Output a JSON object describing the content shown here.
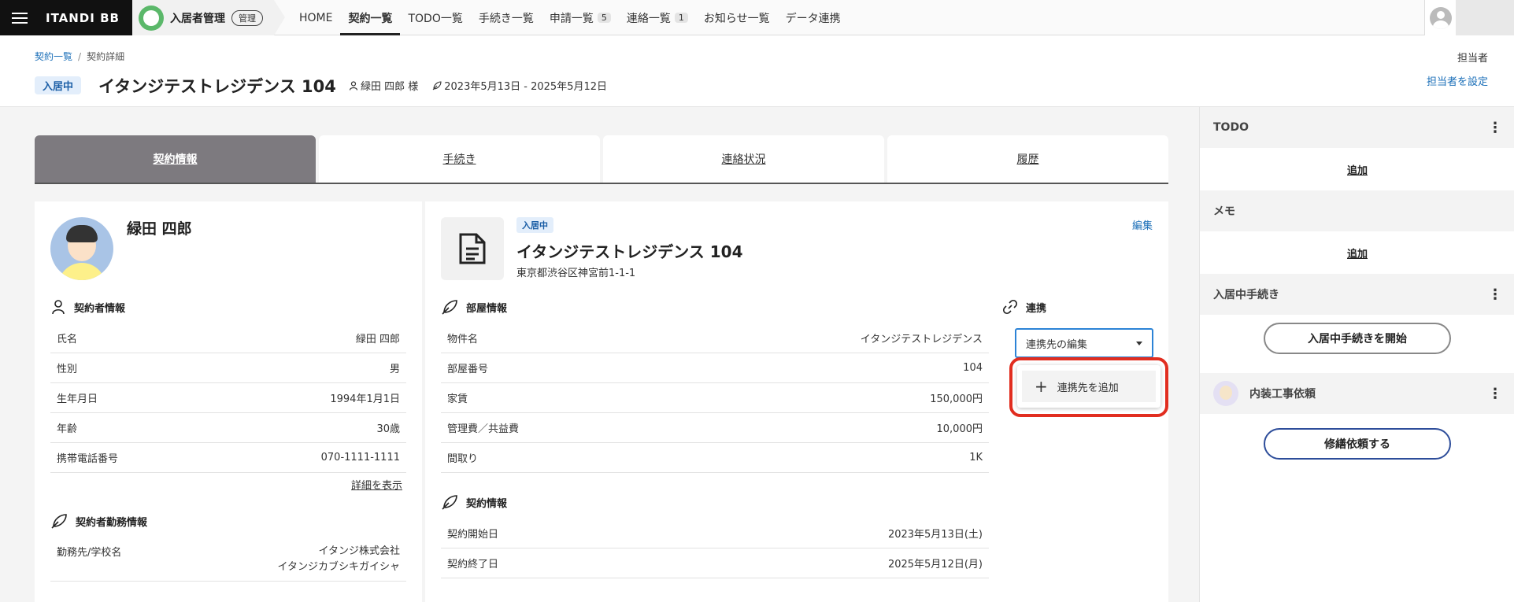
{
  "topbar": {
    "brand": "ITANDI BB",
    "app_name": "入居者管理",
    "app_badge": "管理",
    "nav": [
      {
        "label": "HOME",
        "count": ""
      },
      {
        "label": "契約一覧",
        "count": ""
      },
      {
        "label": "TODO一覧",
        "count": ""
      },
      {
        "label": "手続き一覧",
        "count": ""
      },
      {
        "label": "申請一覧",
        "count": "5"
      },
      {
        "label": "連絡一覧",
        "count": "1"
      },
      {
        "label": "お知らせ一覧",
        "count": ""
      },
      {
        "label": "データ連携",
        "count": ""
      }
    ]
  },
  "header": {
    "breadcrumb": [
      "契約一覧",
      "契約詳細"
    ],
    "status": "入居中",
    "title": "イタンジテストレジデンス 104",
    "tenant": "緑田 四郎 様",
    "period": "2023年5月13日 - 2025年5月12日",
    "assignee_label": "担当者",
    "assignee_link": "担当者を設定"
  },
  "tabs": [
    "契約情報",
    "手続き",
    "連絡状況",
    "履歴"
  ],
  "person": {
    "name": "緑田 四郎",
    "contractor_section": "契約者情報",
    "rows": [
      {
        "k": "氏名",
        "v": "緑田 四郎"
      },
      {
        "k": "性別",
        "v": "男"
      },
      {
        "k": "生年月日",
        "v": "1994年1月1日"
      },
      {
        "k": "年齢",
        "v": "30歳"
      },
      {
        "k": "携帯電話番号",
        "v": "070-1111-1111"
      }
    ],
    "detail_link": "詳細を表示",
    "work_section": "契約者勤務情報",
    "work_rows": [
      {
        "k": "勤務先/学校名",
        "v1": "イタンジ株式会社",
        "v2": "イタンジカブシキガイシャ"
      }
    ]
  },
  "property": {
    "status": "入居中",
    "name": "イタンジテストレジデンス 104",
    "address": "東京都渋谷区神宮前1-1-1",
    "edit": "編集",
    "room_section": "部屋情報",
    "room_rows": [
      {
        "k": "物件名",
        "v": "イタンジテストレジデンス"
      },
      {
        "k": "部屋番号",
        "v": "104"
      },
      {
        "k": "家賃",
        "v": "150,000円"
      },
      {
        "k": "管理費／共益費",
        "v": "10,000円"
      },
      {
        "k": "間取り",
        "v": "1K"
      }
    ],
    "contract_section": "契約情報",
    "contract_rows": [
      {
        "k": "契約開始日",
        "v": "2023年5月13日(土)"
      },
      {
        "k": "契約終了日",
        "v": "2025年5月12日(月)"
      }
    ],
    "link_section": "連携",
    "link_select": "連携先の編集",
    "link_add": "連携先を追加"
  },
  "sidebar": {
    "todo": "TODO",
    "todo_add": "追加",
    "memo": "メモ",
    "memo_add": "追加",
    "procedure": "入居中手続き",
    "procedure_button": "入居中手続きを開始",
    "repair": "内装工事依頼",
    "repair_button": "修繕依頼する"
  },
  "colors": {
    "accent_blue": "#1b6fb8",
    "highlight_red": "#e12d1f",
    "active_tab": "#7d7a7f"
  }
}
